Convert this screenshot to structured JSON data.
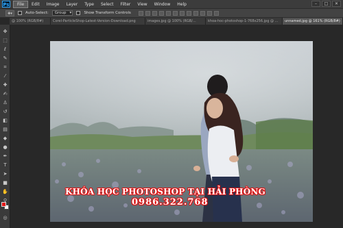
{
  "app": {
    "logo": "Ps",
    "accent": "#31a8ff"
  },
  "menu": [
    "File",
    "Edit",
    "Image",
    "Layer",
    "Type",
    "Select",
    "Filter",
    "View",
    "Window",
    "Help"
  ],
  "window_controls": [
    "–",
    "□",
    "✕"
  ],
  "options": {
    "auto_select_label": "Auto-Select:",
    "auto_select_value": "Group",
    "transform_label": "Show Transform Controls"
  },
  "tabs": [
    {
      "label": "@ 100% (RGB/8#)",
      "active": false
    },
    {
      "label": "Corel-ParticleShop-Latest-Version-Download.png",
      "active": false
    },
    {
      "label": "images.jpg @ 100% (RGB/...",
      "active": false
    },
    {
      "label": "khoa-hoc-photoshop-1-768x256.jpg @ ...",
      "active": false
    },
    {
      "label": "unnamed.jpg @ 161% (RGB/8#)",
      "active": true
    }
  ],
  "toolbar_icons": [
    "move-icon",
    "marquee-icon",
    "lasso-icon",
    "quick-select-icon",
    "crop-icon",
    "eyedropper-icon",
    "healing-icon",
    "brush-icon",
    "clone-stamp-icon",
    "history-brush-icon",
    "eraser-icon",
    "gradient-icon",
    "blur-icon",
    "dodge-icon",
    "pen-icon",
    "type-icon",
    "path-select-icon",
    "shape-icon",
    "hand-icon",
    "zoom-icon"
  ],
  "colors": {
    "foreground": "#e21818",
    "background": "#ffffff",
    "ad_outline": "#e01010"
  },
  "ad": {
    "line1": "KHÓA HỌC PHOTOSHOP TẠI HẢI PHÒNG",
    "line2": "0986.322.768"
  }
}
